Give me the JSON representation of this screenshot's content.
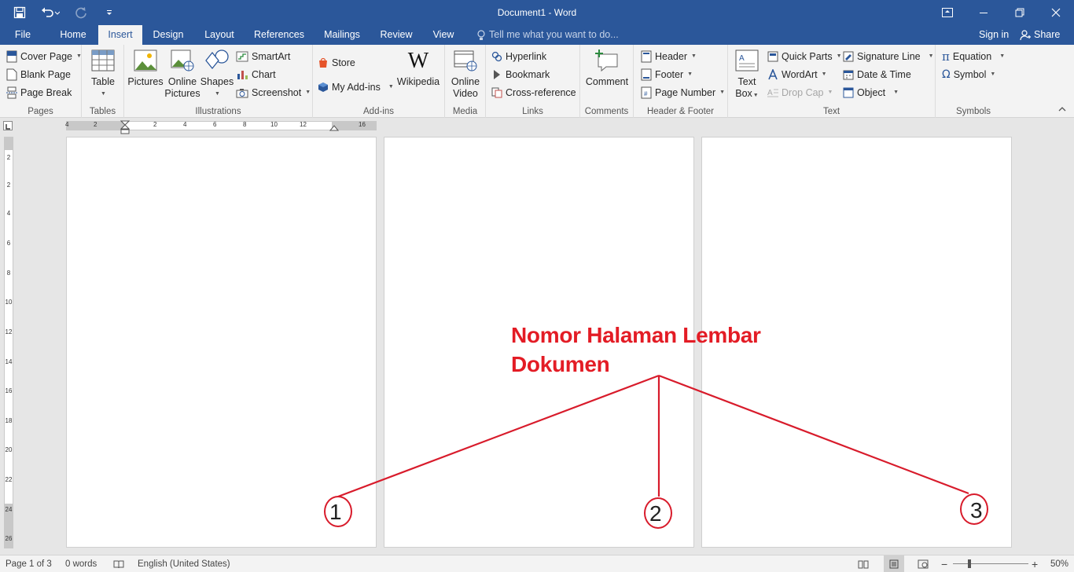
{
  "window": {
    "title": "Document1 - Word"
  },
  "tabs": [
    "File",
    "Home",
    "Insert",
    "Design",
    "Layout",
    "References",
    "Mailings",
    "Review",
    "View"
  ],
  "active_tab": "Insert",
  "tellme_placeholder": "Tell me what you want to do...",
  "account": {
    "signin": "Sign in",
    "share": "Share"
  },
  "ribbon": {
    "pages": {
      "label": "Pages",
      "cover_page": "Cover Page",
      "blank_page": "Blank Page",
      "page_break": "Page Break"
    },
    "tables": {
      "label": "Tables",
      "table": "Table"
    },
    "illustrations": {
      "label": "Illustrations",
      "pictures": "Pictures",
      "online_pictures_1": "Online",
      "online_pictures_2": "Pictures",
      "shapes": "Shapes",
      "smartart": "SmartArt",
      "chart": "Chart",
      "screenshot": "Screenshot"
    },
    "addins": {
      "label": "Add-ins",
      "store": "Store",
      "my_addins": "My Add-ins",
      "wikipedia": "Wikipedia"
    },
    "media": {
      "label": "Media",
      "online_video_1": "Online",
      "online_video_2": "Video"
    },
    "links": {
      "label": "Links",
      "hyperlink": "Hyperlink",
      "bookmark": "Bookmark",
      "cross_reference": "Cross-reference"
    },
    "comments": {
      "label": "Comments",
      "comment": "Comment"
    },
    "header_footer": {
      "label": "Header & Footer",
      "header": "Header",
      "footer": "Footer",
      "page_number": "Page Number"
    },
    "text": {
      "label": "Text",
      "text_box_1": "Text",
      "text_box_2": "Box",
      "quick_parts": "Quick Parts",
      "wordart": "WordArt",
      "drop_cap": "Drop Cap",
      "signature_line": "Signature Line",
      "date_time": "Date & Time",
      "object": "Object"
    },
    "symbols": {
      "label": "Symbols",
      "equation": "Equation",
      "symbol": "Symbol"
    }
  },
  "ruler": {
    "h_labels": [
      "4",
      "2",
      "2",
      "4",
      "6",
      "8",
      "10",
      "12",
      "16"
    ],
    "v_labels": [
      "2",
      "2",
      "4",
      "6",
      "8",
      "10",
      "12",
      "14",
      "16",
      "18",
      "20",
      "22",
      "24",
      "26"
    ]
  },
  "pages": [
    {
      "number": "1"
    },
    {
      "number": "2"
    },
    {
      "number": "3"
    }
  ],
  "annotation": {
    "line1": "Nomor Halaman Lembar",
    "line2": "Dokumen",
    "color": "#e31c25"
  },
  "statusbar": {
    "page_info": "Page 1 of 3",
    "word_count": "0 words",
    "language": "English (United States)",
    "zoom_minus": "−",
    "zoom_plus": "+",
    "zoom": "50%"
  },
  "colors": {
    "accent": "#2b579a",
    "annotation": "#d81b2b"
  }
}
